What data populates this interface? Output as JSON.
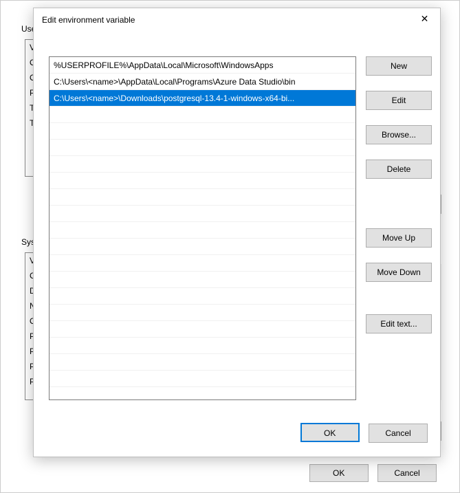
{
  "background": {
    "user_label": "User",
    "system_label": "Syste",
    "user_vars": [
      "Va",
      "On",
      "On",
      "Pat",
      "TE",
      "TM"
    ],
    "system_vars": [
      "Va",
      "Co",
      "Dri",
      "NU",
      "OS",
      "Pat",
      "PA",
      "PO",
      "PR"
    ],
    "ok": "OK",
    "cancel": "Cancel"
  },
  "dialog": {
    "title": "Edit environment variable",
    "close_glyph": "✕",
    "paths": [
      {
        "text": "%USERPROFILE%\\AppData\\Local\\Microsoft\\WindowsApps",
        "selected": false
      },
      {
        "text": "C:\\Users\\<name>\\AppData\\Local\\Programs\\Azure Data Studio\\bin",
        "selected": false
      },
      {
        "text": "C:\\Users\\<name>\\Downloads\\postgresql-13.4-1-windows-x64-bi...",
        "selected": true
      }
    ],
    "buttons": {
      "new": "New",
      "edit": "Edit",
      "browse": "Browse...",
      "delete": "Delete",
      "move_up": "Move Up",
      "move_down": "Move Down",
      "edit_text": "Edit text..."
    },
    "ok": "OK",
    "cancel": "Cancel"
  },
  "scroll": {
    "up": "⏶",
    "down": "⏷"
  }
}
